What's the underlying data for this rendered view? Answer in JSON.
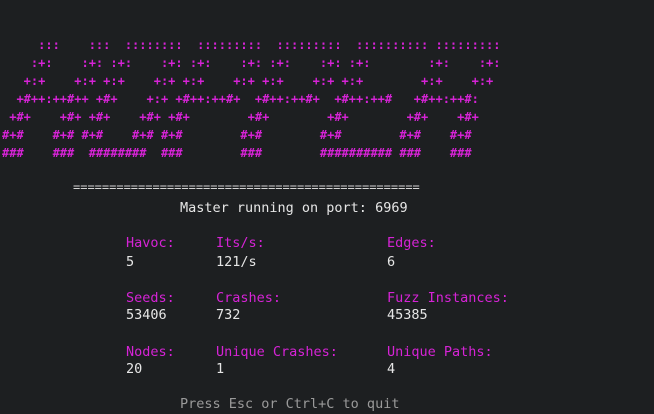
{
  "banner": {
    "color": "#d623d6",
    "lines": [
      "     :::    :::  ::::::::  :::::::::  :::::::::  :::::::::: :::::::::",
      "    :+:    :+: :+:    :+: :+:    :+: :+:    :+: :+:        :+:    :+:",
      "   +:+    +:+ +:+    +:+ +:+    +:+ +:+    +:+ +:+        +:+    +:+",
      "  +#++:++#++ +#+    +:+ +#++:++#+  +#++:++#+  +#++:++#   +#++:++#:",
      " +#+    +#+ +#+    +#+ +#+        +#+        +#+        +#+    +#+",
      "#+#    #+# #+#    #+# #+#        #+#        #+#        #+#    #+#",
      "###    ###  ########  ###        ###        ########## ###    ###"
    ]
  },
  "rule": "================================================",
  "status": "Master running on port: 6969",
  "stats": {
    "havoc": {
      "label": "Havoc:",
      "value": "5"
    },
    "its": {
      "label": "Its/s:",
      "value": "121/s"
    },
    "edges": {
      "label": "Edges:",
      "value": "6"
    },
    "seeds": {
      "label": "Seeds:",
      "value": "53406"
    },
    "crashes": {
      "label": "Crashes:",
      "value": "732"
    },
    "fuzz_instances": {
      "label": "Fuzz Instances:",
      "value": "45385"
    },
    "nodes": {
      "label": "Nodes:",
      "value": "20"
    },
    "unique_crashes": {
      "label": "Unique Crashes:",
      "value": "1"
    },
    "unique_paths": {
      "label": "Unique Paths:",
      "value": "4"
    }
  },
  "footer": "Press Esc or Ctrl+C to quit",
  "colors": {
    "background": "#1d1f21",
    "accent": "#d623d6",
    "text": "#e6e6e6",
    "muted": "#9a9a9a"
  }
}
